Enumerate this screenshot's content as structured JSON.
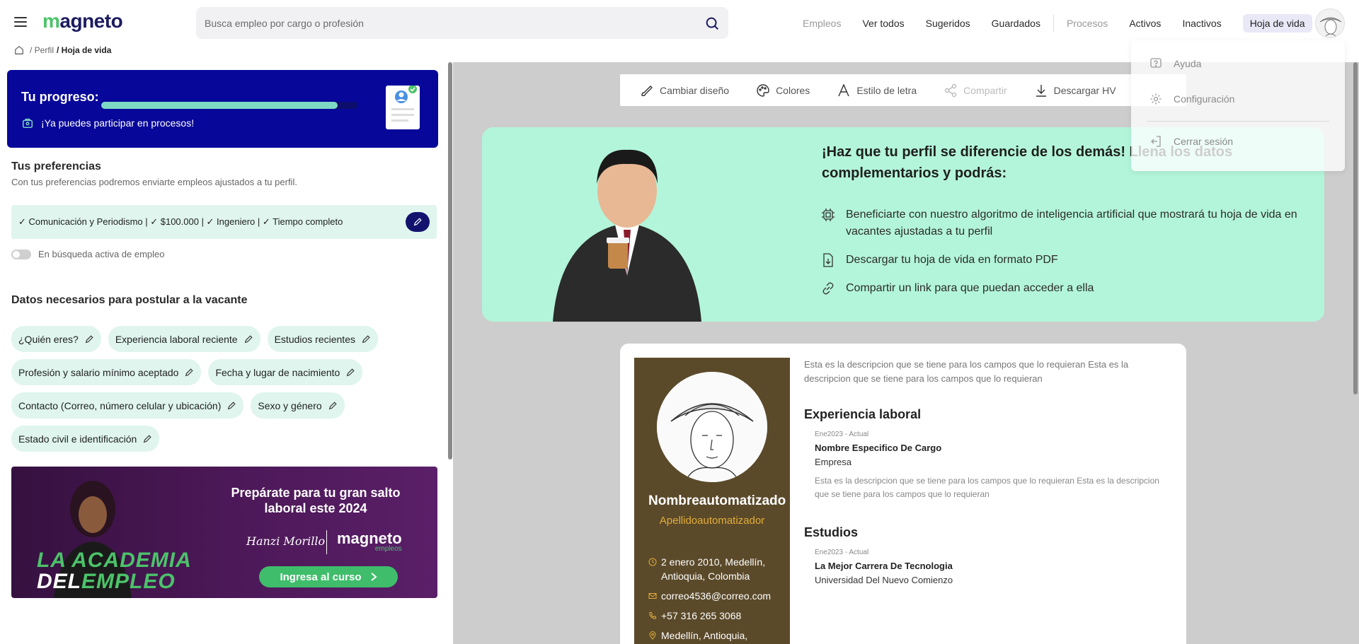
{
  "header": {
    "logo": {
      "first_letter": "m",
      "rest": "agneto"
    },
    "search_placeholder": "Busca empleo por cargo o profesión",
    "nav": {
      "empleos": "Empleos",
      "ver_todos": "Ver todos",
      "sugeridos": "Sugeridos",
      "guardados": "Guardados",
      "procesos": "Procesos",
      "activos": "Activos",
      "inactivos": "Inactivos",
      "hoja_de_vida": "Hoja de vida"
    }
  },
  "breadcrumb": {
    "perfil": "/ Perfil",
    "current": "/ Hoja de vida"
  },
  "progress": {
    "title": "Tu progreso:",
    "value": 0.92,
    "message": "¡Ya puedes participar en procesos!"
  },
  "preferences": {
    "title": "Tus preferencias",
    "subtitle": "Con tus preferencias podremos enviarte empleos ajustados a tu perfil.",
    "summary": "✓ Comunicación y Periodismo | ✓ $100.000 | ✓ Ingeniero | ✓ Tiempo completo",
    "active_search_label": "En búsqueda activa de empleo",
    "active_search_on": false
  },
  "datos": {
    "title": "Datos necesarios para postular a la vacante",
    "chips": [
      "¿Quién eres?",
      "Experiencia laboral reciente",
      "Estudios recientes",
      "Profesión y salario mínimo aceptado",
      "Fecha y lugar de nacimiento",
      "Contacto (Correo, número celular y ubicación)",
      "Sexo y género",
      "Estado civil e identificación"
    ]
  },
  "banner": {
    "title": "Prepárate para tu gran salto laboral este 2024",
    "signature": "Hanzi Morillo",
    "logo_main": "magneto",
    "logo_sub": "empleos",
    "button": "Ingresa al curso",
    "academia_line1": "LA ACADEMIA",
    "academia_line2a": "DEL",
    "academia_line2b": "EMPLEO"
  },
  "toolbar": {
    "cambiar_diseno": "Cambiar diseño",
    "colores": "Colores",
    "estilo_letra": "Estilo de letra",
    "compartir": "Compartir",
    "descargar": "Descargar HV"
  },
  "promo": {
    "title": "¡Haz que tu perfil se diferencie de los demás! Llena los datos complementarios y podrás:",
    "items": [
      "Beneficiarte con nuestro algoritmo de inteligencia artificial que mostrará tu hoja de vida en vacantes ajustadas a tu perfil",
      "Descargar tu hoja de vida en formato PDF",
      "Compartir un link para que puedan acceder a ella"
    ]
  },
  "cv": {
    "name": "Nombreautomatizado",
    "surname": "Apellidoautomatizador",
    "birth": "2 enero 2010, Medellín, Antioquia, Colombia",
    "email": "correo4536@correo.com",
    "phone": "+57 316 265 3068",
    "location": "Medellín, Antioquia, Colombia",
    "description": "Esta es la descripcion que se tiene para los campos que lo requieran Esta es la descripcion que se tiene para los campos que lo requieran",
    "experience_title": "Experiencia laboral",
    "experience": {
      "date": "Ene2023 - Actual",
      "role": "Nombre Especifico De Cargo",
      "company": "Empresa",
      "description": "Esta es la descripcion que se tiene para los campos que lo requieran Esta es la descripcion que se tiene para los campos que lo requieran"
    },
    "studies_title": "Estudios",
    "study": {
      "date": "Ene2023 - Actual",
      "degree": "La Mejor Carrera De Tecnologia",
      "institution": "Universidad Del Nuevo Comienzo"
    }
  },
  "user_menu": {
    "ayuda": "Ayuda",
    "configuracion": "Configuración",
    "cerrar_sesion": "Cerrar sesión"
  },
  "colors": {
    "brand_green": "#4cc36a",
    "brand_navy": "#07079a",
    "promo_bg": "#b3f5da",
    "chip_bg": "#dff5ee",
    "cv_sidebar": "#5b4a2a"
  }
}
